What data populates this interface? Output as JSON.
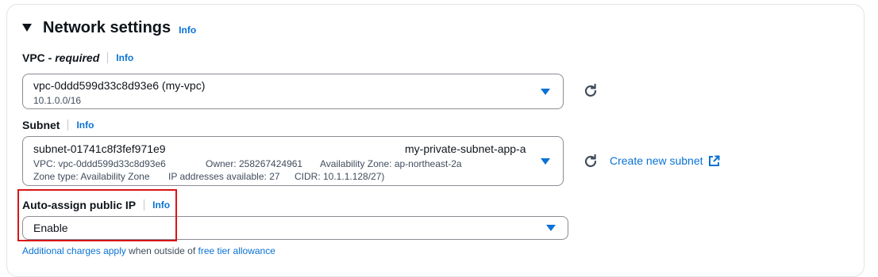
{
  "section": {
    "title": "Network settings",
    "info": "Info"
  },
  "vpc": {
    "label": "VPC - ",
    "label_required": "required",
    "info": "Info",
    "selected_value": "vpc-0ddd599d33c8d93e6 (my-vpc)",
    "selected_description": "10.1.0.0/16"
  },
  "subnet": {
    "label": "Subnet",
    "info": "Info",
    "selected_value": "subnet-01741c8f3fef971e9",
    "selected_name": "my-private-subnet-app-a",
    "details_line1": {
      "vpc": "VPC: vpc-0ddd599d33c8d93e6",
      "owner": "Owner: 258267424961",
      "az": "Availability Zone: ap-northeast-2a"
    },
    "details_line2": {
      "zone_type": "Zone type: Availability Zone",
      "ips": "IP addresses available: 27",
      "cidr": "CIDR: 10.1.1.128/27)"
    },
    "create_new_label": "Create new subnet"
  },
  "auto_assign": {
    "label": "Auto-assign public IP",
    "info": "Info",
    "selected_value": "Enable",
    "highlight_color": "#d91515"
  },
  "footer": {
    "charges_link": "Additional charges apply",
    "middle_text": " when outside of ",
    "tier_link": "free tier allowance"
  },
  "colors": {
    "accent": "#0972d3",
    "text": "#0f141a",
    "border": "#8c8c94"
  },
  "icons": [
    "caret-down-icon",
    "refresh-icon",
    "dropdown-caret-icon",
    "external-link-icon"
  ]
}
